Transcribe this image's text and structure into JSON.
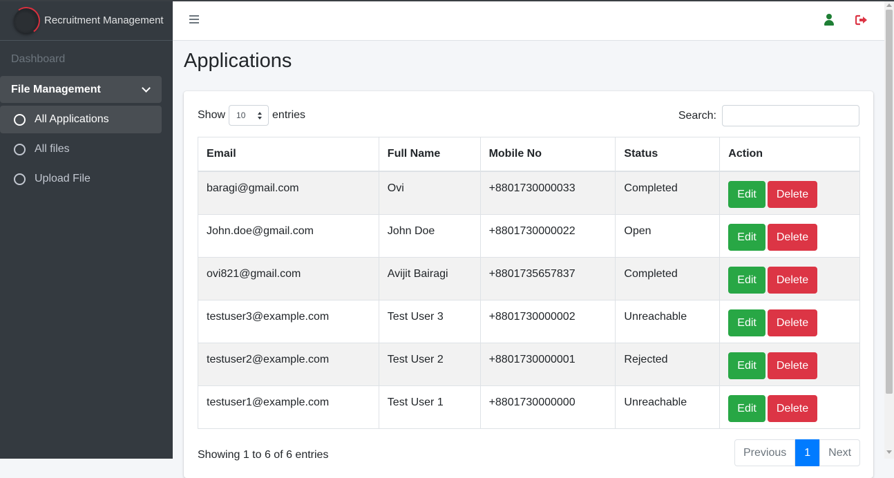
{
  "brand": {
    "name": "Recruitment Management"
  },
  "sidebar": {
    "dashboard": "Dashboard",
    "group": "File Management",
    "items": [
      {
        "label": "All Applications"
      },
      {
        "label": "All files"
      },
      {
        "label": "Upload File"
      }
    ]
  },
  "page": {
    "title": "Applications"
  },
  "table_controls": {
    "show_prefix": "Show",
    "page_length": "10",
    "show_suffix": "entries",
    "search_label": "Search:",
    "search_value": ""
  },
  "columns": [
    "Email",
    "Full Name",
    "Mobile No",
    "Status",
    "Action"
  ],
  "rows": [
    {
      "email": "baragi@gmail.com",
      "name": "Ovi",
      "mobile": "+8801730000033",
      "status": "Completed"
    },
    {
      "email": "John.doe@gmail.com",
      "name": "John Doe",
      "mobile": "+8801730000022",
      "status": "Open"
    },
    {
      "email": "ovi821@gmail.com",
      "name": "Avijit Bairagi",
      "mobile": "+8801735657837",
      "status": "Completed"
    },
    {
      "email": "testuser3@example.com",
      "name": "Test User 3",
      "mobile": "+8801730000002",
      "status": "Unreachable"
    },
    {
      "email": "testuser2@example.com",
      "name": "Test User 2",
      "mobile": "+8801730000001",
      "status": "Rejected"
    },
    {
      "email": "testuser1@example.com",
      "name": "Test User 1",
      "mobile": "+8801730000000",
      "status": "Unreachable"
    }
  ],
  "actions": {
    "edit": "Edit",
    "delete": "Delete"
  },
  "footer": {
    "info": "Showing 1 to 6 of 6 entries",
    "prev": "Previous",
    "current_page": "1",
    "next": "Next"
  },
  "colors": {
    "sidebar_bg": "#343a40",
    "edit_button": "#28a745",
    "delete_button": "#dc3545",
    "page_active": "#007bff",
    "user_icon": "#1e7e34",
    "logout_icon": "#dc3545"
  },
  "icons": {
    "menu": "hamburger-icon",
    "user": "user-icon",
    "logout": "sign-out-icon"
  }
}
